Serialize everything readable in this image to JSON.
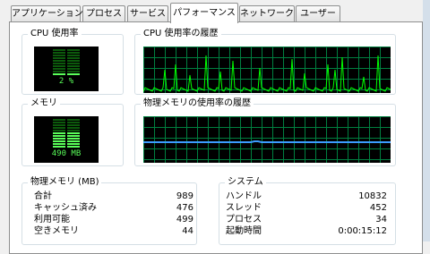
{
  "tabs": [
    {
      "label": "アプリケーション"
    },
    {
      "label": "プロセス"
    },
    {
      "label": "サービス"
    },
    {
      "label": "パフォーマンス"
    },
    {
      "label": "ネットワーク"
    },
    {
      "label": "ユーザー"
    }
  ],
  "active_tab_index": 3,
  "cpu_usage": {
    "title": "CPU 使用率",
    "value_text": "2 %",
    "fill_fraction": 0.02
  },
  "cpu_history": {
    "title": "CPU 使用率の履歴"
  },
  "memory": {
    "title": "メモリ",
    "value_text": "490 MB",
    "fill_fraction": 0.5
  },
  "memory_history": {
    "title": "物理メモリの使用率の履歴"
  },
  "physical_memory": {
    "title": "物理メモリ (MB)",
    "rows": [
      {
        "label": "合計",
        "value": "989"
      },
      {
        "label": "キャッシュ済み",
        "value": "476"
      },
      {
        "label": "利用可能",
        "value": "499"
      },
      {
        "label": "空きメモリ",
        "value": "44"
      }
    ]
  },
  "system": {
    "title": "システム",
    "rows": [
      {
        "label": "ハンドル",
        "value": "10832"
      },
      {
        "label": "スレッド",
        "value": "452"
      },
      {
        "label": "プロセス",
        "value": "34"
      },
      {
        "label": "起動時間",
        "value": "0:00:15:12"
      }
    ]
  },
  "colors": {
    "graph_bg": "#000000",
    "grid": "#008040",
    "cpu_line": "#00ff00",
    "memory_line": "#3c9cff",
    "meter_on": "#5aff5a",
    "meter_off": "#0c5a0c"
  }
}
